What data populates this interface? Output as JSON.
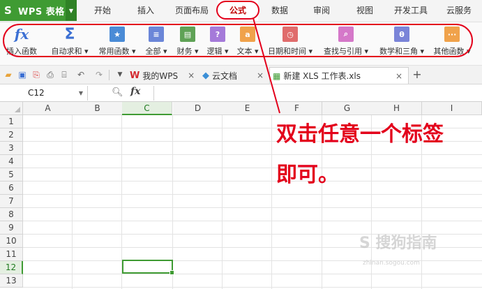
{
  "app": {
    "title": "WPS 表格"
  },
  "menu": {
    "tabs": [
      "开始",
      "插入",
      "页面布局",
      "公式",
      "数据",
      "审阅",
      "视图",
      "开发工具",
      "云服务"
    ],
    "active": "公式"
  },
  "ribbon": {
    "items": [
      {
        "label": "插入函数",
        "icon": "fx-icon"
      },
      {
        "label": "自动求和 ▾",
        "icon": "sum-icon"
      },
      {
        "label": "常用函数 ▾",
        "icon": "star-icon"
      },
      {
        "label": "全部 ▾",
        "icon": "list-icon"
      },
      {
        "label": "财务 ▾",
        "icon": "finance-icon"
      },
      {
        "label": "逻辑 ▾",
        "icon": "question-icon"
      },
      {
        "label": "文本 ▾",
        "icon": "text-icon"
      },
      {
        "label": "日期和时间 ▾",
        "icon": "clock-icon"
      },
      {
        "label": "查找与引用 ▾",
        "icon": "search-icon"
      },
      {
        "label": "数学和三角 ▾",
        "icon": "theta-icon"
      },
      {
        "label": "其他函数 ▾",
        "icon": "more-icon"
      }
    ],
    "colors": {
      "blue": "#3b6fd3",
      "purple": "#a57ad9",
      "orange": "#f0a24b",
      "green": "#5fa256",
      "red": "#e06c6c",
      "pink": "#d578c9"
    }
  },
  "doc_tabs": [
    {
      "label": "我的WPS",
      "icon": "wps-logo-icon"
    },
    {
      "label": "云文档",
      "icon": "cloud-icon"
    },
    {
      "label": "新建 XLS 工作表.xls",
      "icon": "sheet-icon"
    }
  ],
  "formula_bar": {
    "cell_ref": "C12",
    "fx": "fx"
  },
  "grid": {
    "columns": [
      "A",
      "B",
      "C",
      "D",
      "E",
      "F",
      "G",
      "H",
      "I"
    ],
    "rows": [
      "1",
      "2",
      "3",
      "4",
      "5",
      "6",
      "7",
      "8",
      "9",
      "10",
      "11",
      "12",
      "13"
    ],
    "selected_column": "C",
    "selected_row": "12"
  },
  "annotation": {
    "line1": "双击任意一个标签",
    "line2": "即可。",
    "color": "#e3001b"
  },
  "watermark": {
    "text": "S 搜狗指南",
    "url": "zhinan.sogou.com"
  }
}
